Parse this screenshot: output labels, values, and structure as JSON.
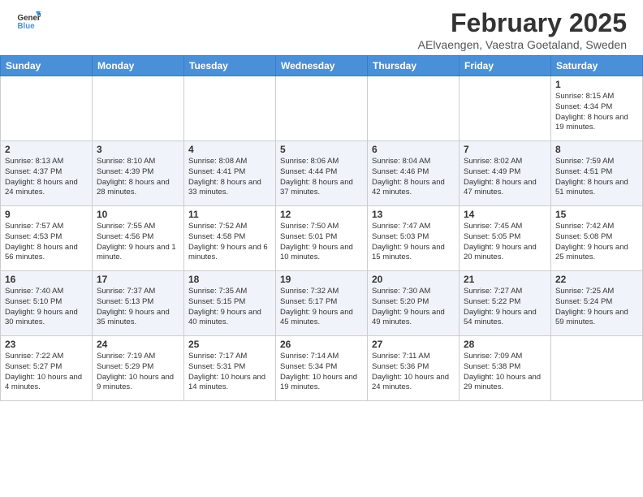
{
  "header": {
    "logo_general": "General",
    "logo_blue": "Blue",
    "title": "February 2025",
    "subtitle": "AElvaengen, Vaestra Goetaland, Sweden"
  },
  "weekdays": [
    "Sunday",
    "Monday",
    "Tuesday",
    "Wednesday",
    "Thursday",
    "Friday",
    "Saturday"
  ],
  "weeks": [
    [
      {
        "day": "",
        "info": ""
      },
      {
        "day": "",
        "info": ""
      },
      {
        "day": "",
        "info": ""
      },
      {
        "day": "",
        "info": ""
      },
      {
        "day": "",
        "info": ""
      },
      {
        "day": "",
        "info": ""
      },
      {
        "day": "1",
        "info": "Sunrise: 8:15 AM\nSunset: 4:34 PM\nDaylight: 8 hours and 19 minutes."
      }
    ],
    [
      {
        "day": "2",
        "info": "Sunrise: 8:13 AM\nSunset: 4:37 PM\nDaylight: 8 hours and 24 minutes."
      },
      {
        "day": "3",
        "info": "Sunrise: 8:10 AM\nSunset: 4:39 PM\nDaylight: 8 hours and 28 minutes."
      },
      {
        "day": "4",
        "info": "Sunrise: 8:08 AM\nSunset: 4:41 PM\nDaylight: 8 hours and 33 minutes."
      },
      {
        "day": "5",
        "info": "Sunrise: 8:06 AM\nSunset: 4:44 PM\nDaylight: 8 hours and 37 minutes."
      },
      {
        "day": "6",
        "info": "Sunrise: 8:04 AM\nSunset: 4:46 PM\nDaylight: 8 hours and 42 minutes."
      },
      {
        "day": "7",
        "info": "Sunrise: 8:02 AM\nSunset: 4:49 PM\nDaylight: 8 hours and 47 minutes."
      },
      {
        "day": "8",
        "info": "Sunrise: 7:59 AM\nSunset: 4:51 PM\nDaylight: 8 hours and 51 minutes."
      }
    ],
    [
      {
        "day": "9",
        "info": "Sunrise: 7:57 AM\nSunset: 4:53 PM\nDaylight: 8 hours and 56 minutes."
      },
      {
        "day": "10",
        "info": "Sunrise: 7:55 AM\nSunset: 4:56 PM\nDaylight: 9 hours and 1 minute."
      },
      {
        "day": "11",
        "info": "Sunrise: 7:52 AM\nSunset: 4:58 PM\nDaylight: 9 hours and 6 minutes."
      },
      {
        "day": "12",
        "info": "Sunrise: 7:50 AM\nSunset: 5:01 PM\nDaylight: 9 hours and 10 minutes."
      },
      {
        "day": "13",
        "info": "Sunrise: 7:47 AM\nSunset: 5:03 PM\nDaylight: 9 hours and 15 minutes."
      },
      {
        "day": "14",
        "info": "Sunrise: 7:45 AM\nSunset: 5:05 PM\nDaylight: 9 hours and 20 minutes."
      },
      {
        "day": "15",
        "info": "Sunrise: 7:42 AM\nSunset: 5:08 PM\nDaylight: 9 hours and 25 minutes."
      }
    ],
    [
      {
        "day": "16",
        "info": "Sunrise: 7:40 AM\nSunset: 5:10 PM\nDaylight: 9 hours and 30 minutes."
      },
      {
        "day": "17",
        "info": "Sunrise: 7:37 AM\nSunset: 5:13 PM\nDaylight: 9 hours and 35 minutes."
      },
      {
        "day": "18",
        "info": "Sunrise: 7:35 AM\nSunset: 5:15 PM\nDaylight: 9 hours and 40 minutes."
      },
      {
        "day": "19",
        "info": "Sunrise: 7:32 AM\nSunset: 5:17 PM\nDaylight: 9 hours and 45 minutes."
      },
      {
        "day": "20",
        "info": "Sunrise: 7:30 AM\nSunset: 5:20 PM\nDaylight: 9 hours and 49 minutes."
      },
      {
        "day": "21",
        "info": "Sunrise: 7:27 AM\nSunset: 5:22 PM\nDaylight: 9 hours and 54 minutes."
      },
      {
        "day": "22",
        "info": "Sunrise: 7:25 AM\nSunset: 5:24 PM\nDaylight: 9 hours and 59 minutes."
      }
    ],
    [
      {
        "day": "23",
        "info": "Sunrise: 7:22 AM\nSunset: 5:27 PM\nDaylight: 10 hours and 4 minutes."
      },
      {
        "day": "24",
        "info": "Sunrise: 7:19 AM\nSunset: 5:29 PM\nDaylight: 10 hours and 9 minutes."
      },
      {
        "day": "25",
        "info": "Sunrise: 7:17 AM\nSunset: 5:31 PM\nDaylight: 10 hours and 14 minutes."
      },
      {
        "day": "26",
        "info": "Sunrise: 7:14 AM\nSunset: 5:34 PM\nDaylight: 10 hours and 19 minutes."
      },
      {
        "day": "27",
        "info": "Sunrise: 7:11 AM\nSunset: 5:36 PM\nDaylight: 10 hours and 24 minutes."
      },
      {
        "day": "28",
        "info": "Sunrise: 7:09 AM\nSunset: 5:38 PM\nDaylight: 10 hours and 29 minutes."
      },
      {
        "day": "",
        "info": ""
      }
    ]
  ]
}
